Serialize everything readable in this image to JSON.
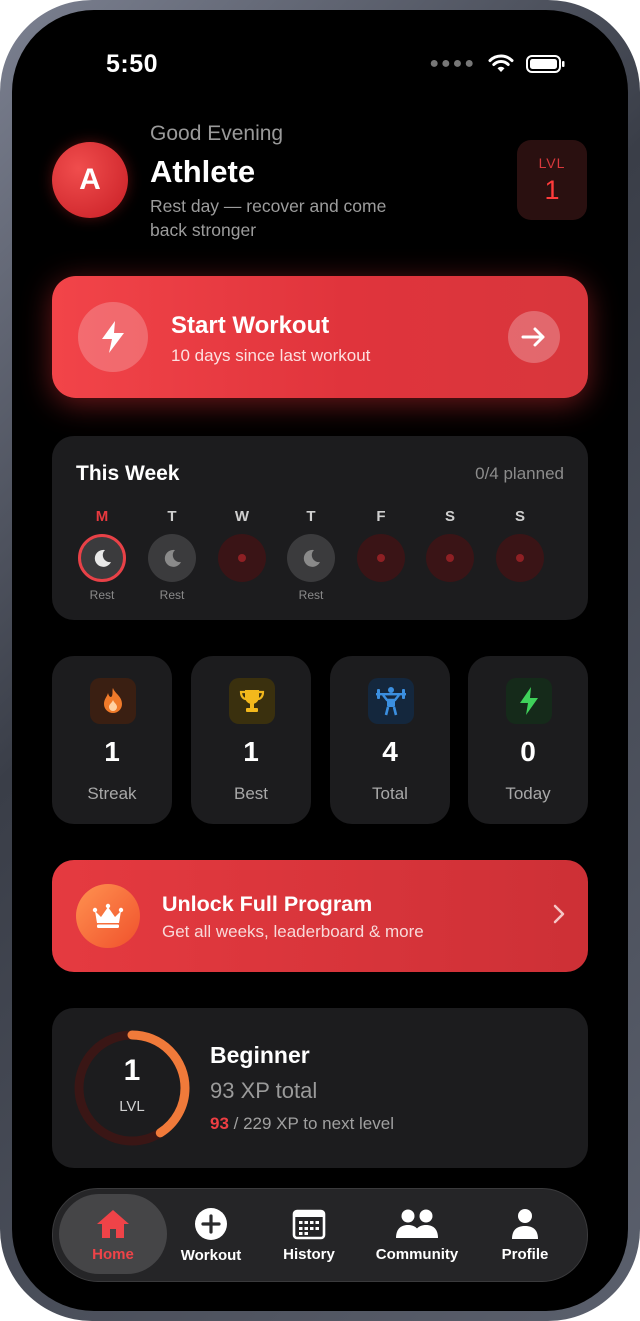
{
  "status": {
    "time": "5:50"
  },
  "header": {
    "avatar_initial": "A",
    "greeting": "Good Evening",
    "name": "Athlete",
    "subtitle": "Rest day — recover and come back stronger",
    "level_label": "LVL",
    "level_value": "1"
  },
  "start_workout": {
    "title": "Start Workout",
    "subtitle": "10 days since last workout"
  },
  "week": {
    "title": "This Week",
    "planned": "0/4 planned",
    "days": [
      {
        "letter": "M",
        "state": "today",
        "note": "Rest"
      },
      {
        "letter": "T",
        "state": "rest",
        "note": "Rest"
      },
      {
        "letter": "W",
        "state": "planned",
        "note": ""
      },
      {
        "letter": "T",
        "state": "rest",
        "note": "Rest"
      },
      {
        "letter": "F",
        "state": "planned",
        "note": ""
      },
      {
        "letter": "S",
        "state": "planned",
        "note": ""
      },
      {
        "letter": "S",
        "state": "planned",
        "note": ""
      }
    ]
  },
  "stats": [
    {
      "icon": "flame-icon",
      "value": "1",
      "label": "Streak"
    },
    {
      "icon": "trophy-icon",
      "value": "1",
      "label": "Best"
    },
    {
      "icon": "weightlifter-icon",
      "value": "4",
      "label": "Total"
    },
    {
      "icon": "bolt-icon",
      "value": "0",
      "label": "Today"
    }
  ],
  "unlock": {
    "title": "Unlock Full Program",
    "subtitle": "Get all weeks, leaderboard & more"
  },
  "level": {
    "value": "1",
    "label": "LVL",
    "rank": "Beginner",
    "xp_total": "93 XP total",
    "xp_current": "93",
    "xp_next": " / 229 XP to next level",
    "progress_fraction": 0.41
  },
  "tabs": [
    {
      "label": "Home",
      "icon": "home-icon",
      "active": true
    },
    {
      "label": "Workout",
      "icon": "plus-circle-icon",
      "active": false
    },
    {
      "label": "History",
      "icon": "calendar-icon",
      "active": false
    },
    {
      "label": "Community",
      "icon": "people-icon",
      "active": false
    },
    {
      "label": "Profile",
      "icon": "person-icon",
      "active": false
    }
  ],
  "colors": {
    "accent": "#E8393F",
    "background": "#000000",
    "card": "#1C1C1E"
  }
}
